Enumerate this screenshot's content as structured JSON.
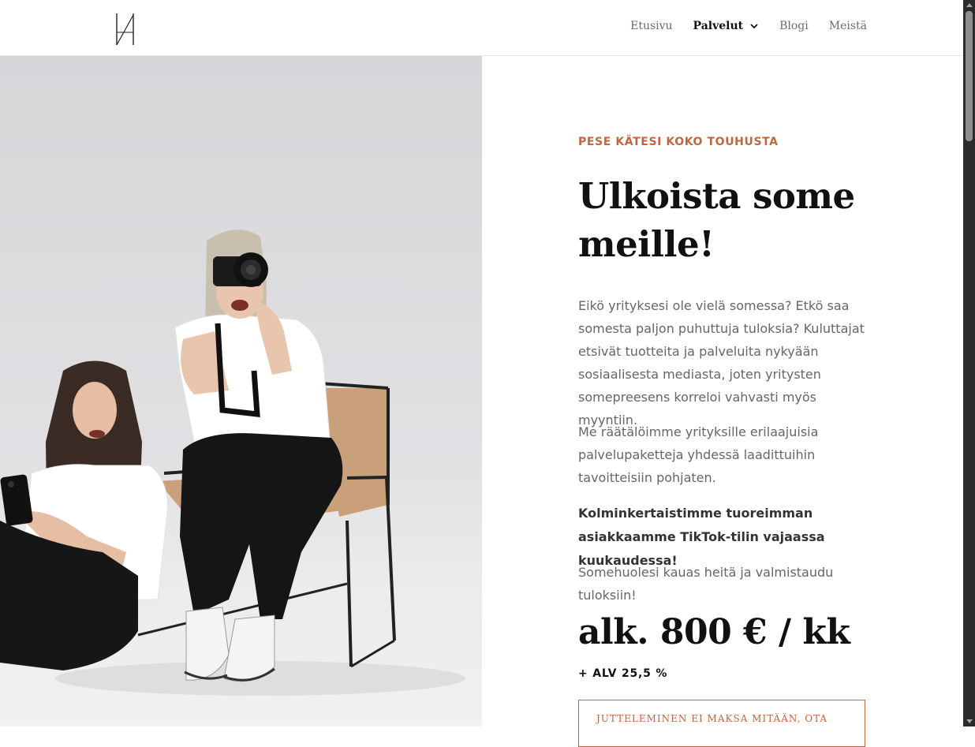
{
  "header": {
    "logo_text": "H",
    "nav": [
      {
        "label": "Etusivu"
      },
      {
        "label": "Palvelut",
        "active": true,
        "has_dropdown": true
      },
      {
        "label": "Blogi"
      },
      {
        "label": "Meistä"
      }
    ]
  },
  "hero_photo": {
    "icons": [
      "camera-icon",
      "smartphone-icon"
    ]
  },
  "main": {
    "eyebrow": "PESE KÄTESI KOKO TOUHUSTA",
    "title_line1": "Ulkoista some",
    "title_line2": "meille!",
    "paragraph1": "Eikö yrityksesi ole vielä somessa? Etkö saa somesta paljon puhuttuja tuloksia? Kuluttajat etsivät tuotteita ja palveluita nykyään sosiaalisesta mediasta, joten yritysten somepreesens korreloi vahvasti myös myyntiin.",
    "paragraph2": "Me räätälöimme yrityksille erilaajuisia palvelupaketteja yhdessä laadittuihin tavoitteisiin pohjaten.",
    "highlight": "Kolminkertaistimme tuoreimman asiakkaamme TikTok-tilin vajaassa kuukaudessa!",
    "paragraph3": "Somehuolesi kauas heitä ja valmistaudu tuloksiin!",
    "price": "alk. 800 € / kk",
    "vat": "+ ALV 25,5 %",
    "cta_label": "JUTTELEMINEN EI MAKSA MITÄÄN, OTA"
  },
  "colors": {
    "accent": "#c0673c",
    "text_dark": "#111111",
    "text_body": "#666666"
  }
}
